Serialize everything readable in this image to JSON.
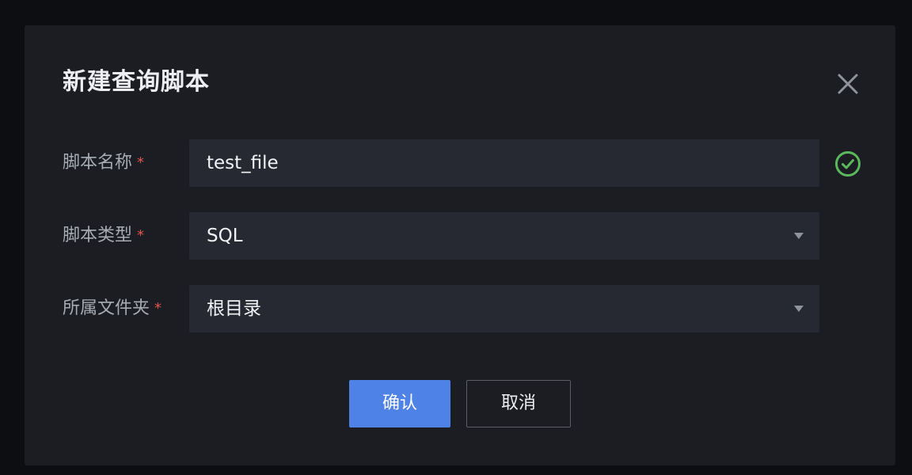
{
  "dialog": {
    "title": "新建查询脚本",
    "close_icon": "close-icon"
  },
  "form": {
    "script_name": {
      "label": "脚本名称",
      "required_mark": "*",
      "value": "test_file",
      "status_icon": "check-circle-icon"
    },
    "script_type": {
      "label": "脚本类型",
      "required_mark": "*",
      "value": "SQL",
      "icon": "chevron-down-icon"
    },
    "folder": {
      "label": "所属文件夹",
      "required_mark": "*",
      "value": "根目录",
      "icon": "chevron-down-icon"
    }
  },
  "actions": {
    "confirm_label": "确认",
    "cancel_label": "取消"
  },
  "colors": {
    "primary": "#4e82e6",
    "success": "#5cb85c",
    "required": "#e0554f",
    "modal_bg": "#1b1d23",
    "field_bg": "#262931"
  }
}
